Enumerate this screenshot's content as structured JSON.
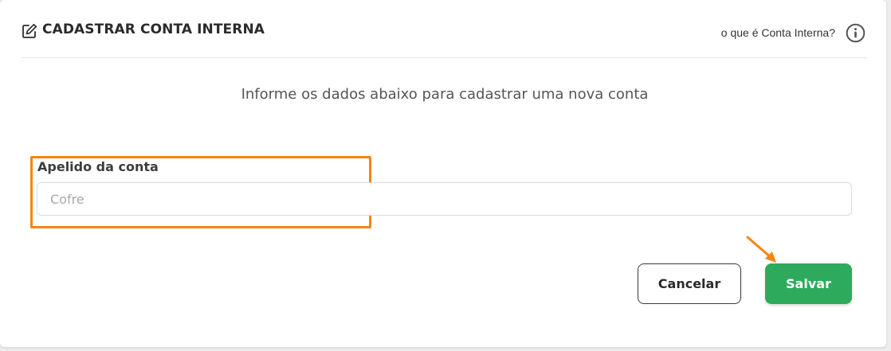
{
  "header": {
    "title": "CADASTRAR CONTA INTERNA",
    "help_link": "o que é Conta Interna?",
    "edit_icon": "edit-icon",
    "info_icon": "info-icon"
  },
  "form": {
    "subtitle": "Informe os dados abaixo para cadastrar uma nova conta",
    "nickname_label": "Apelido da conta",
    "nickname_placeholder": "Cofre",
    "nickname_value": ""
  },
  "actions": {
    "cancel_label": "Cancelar",
    "save_label": "Salvar"
  },
  "colors": {
    "highlight": "#f5850f",
    "save_button": "#2eaa5c",
    "text_dark": "#2b2b2b"
  }
}
